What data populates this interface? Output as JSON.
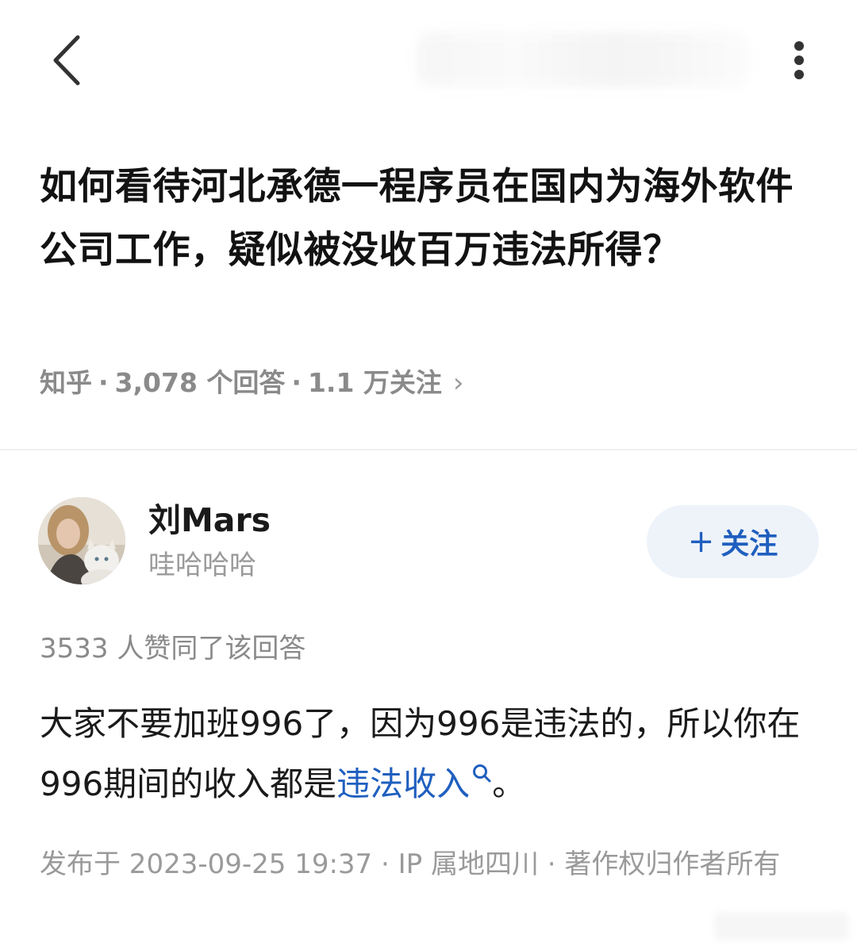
{
  "topbar": {
    "back_icon": "chevron-left-icon",
    "more_icon": "more-vertical-icon"
  },
  "question": {
    "title": "如何看待河北承德一程序员在国内为海外软件公司工作，疑似被没收百万违法所得？",
    "source": "知乎",
    "answers_count": "3,078 个回答",
    "followers": "1.1 万关注",
    "chevron": "›"
  },
  "answer": {
    "author": {
      "name": "刘Mars",
      "bio": "哇哈哈哈",
      "follow_label": "关注",
      "follow_prefix": "+"
    },
    "votes_text": "3533 人赞同了该回答",
    "body_before": "大家不要加班996了，因为996是违法的，所以你在996期间的收入都是",
    "link_text": "违法收入",
    "body_after": "。",
    "published": "发布于 2023-09-25 19:37 · IP 属地四川 · 著作权归作者所有"
  },
  "colors": {
    "link": "#1f5fbf",
    "follow_bg": "#eef3fa",
    "meta_text": "#8a8a8a"
  }
}
